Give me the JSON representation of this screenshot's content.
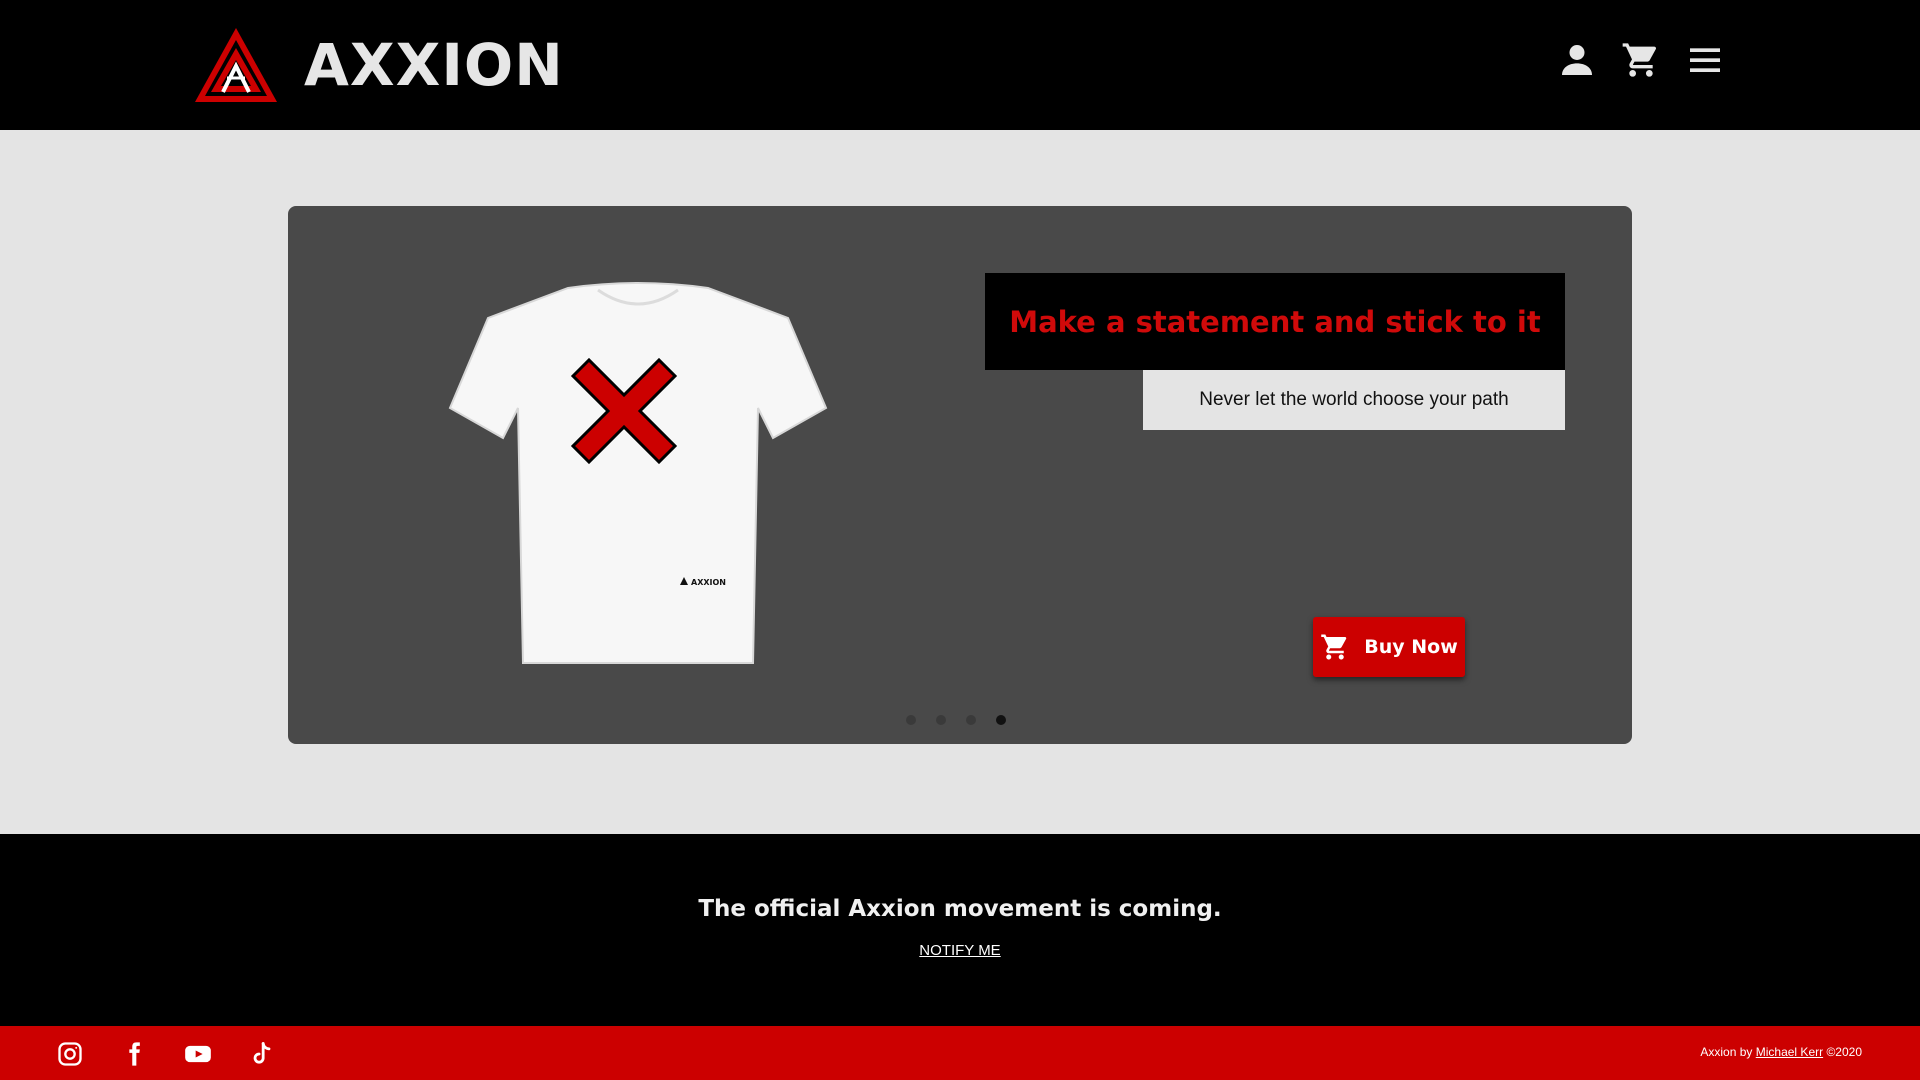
{
  "header": {
    "brand_name": "AXXION",
    "icons": [
      "account-icon",
      "cart-icon",
      "menu-icon"
    ]
  },
  "hero": {
    "headline": "Make a statement and stick to it",
    "subheadline": "Never let the world choose your path",
    "buy_label": "Buy Now",
    "shirt_tag": "AXXION",
    "slide_count": 4,
    "active_slide": 4
  },
  "notify": {
    "title": "The official Axxion movement is coming.",
    "link_label": "NOTIFY ME"
  },
  "footer": {
    "social": [
      "instagram-icon",
      "facebook-icon",
      "youtube-icon",
      "tiktok-icon"
    ],
    "credit_prefix": "Axxion by",
    "credit_name": "Michael Kerr",
    "credit_suffix": "©2020"
  },
  "colors": {
    "brand_red": "#cc0000",
    "header_bg": "#000000",
    "page_bg": "#e4e4e4",
    "carousel_bg": "#494949",
    "headline_red": "#d00a0a"
  }
}
